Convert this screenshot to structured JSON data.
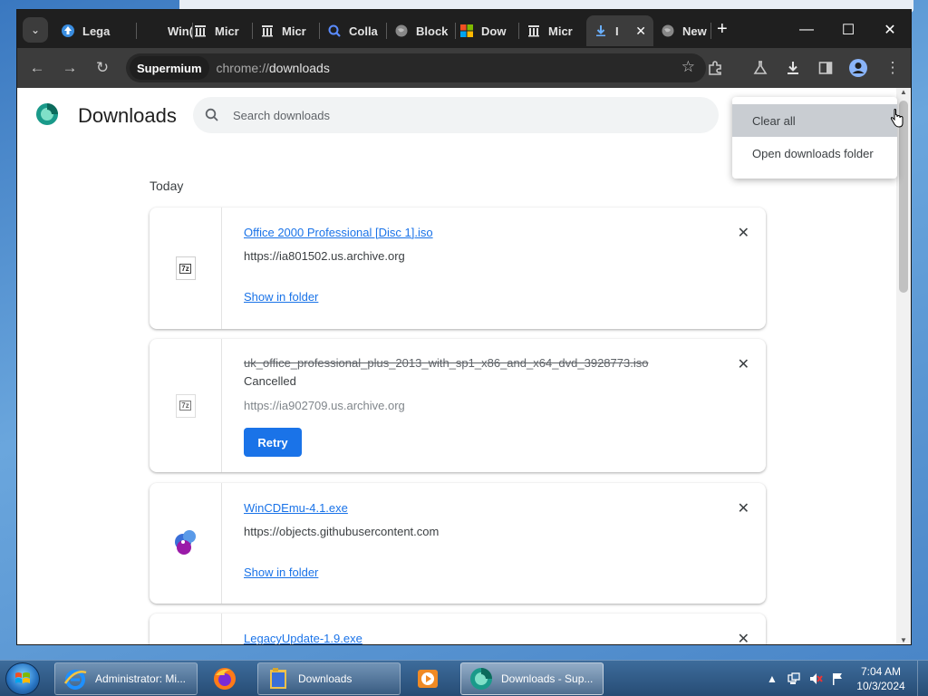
{
  "browser": {
    "tabs": [
      {
        "label": "Lega",
        "icon": "upload-arrow-icon",
        "active": false
      },
      {
        "label": "Win(",
        "icon": "blank-icon",
        "active": false
      },
      {
        "label": "Micr",
        "icon": "archive-icon",
        "active": false
      },
      {
        "label": "Micr",
        "icon": "archive-icon",
        "active": false
      },
      {
        "label": "Colla",
        "icon": "search-icon",
        "active": false
      },
      {
        "label": "Block",
        "icon": "globe-icon",
        "active": false
      },
      {
        "label": "Dow",
        "icon": "windows-icon",
        "active": false
      },
      {
        "label": "Micr",
        "icon": "archive-icon",
        "active": false
      },
      {
        "label": "I",
        "icon": "download-icon",
        "active": true
      },
      {
        "label": "New",
        "icon": "globe-icon",
        "active": false
      }
    ],
    "profile_chip": "Supermium",
    "url_scheme": "chrome://",
    "url_path": "downloads"
  },
  "page": {
    "title": "Downloads",
    "search_placeholder": "Search downloads",
    "section": "Today",
    "items": [
      {
        "filename": "Office 2000 Professional [Disc 1].iso",
        "source": "https://ia801502.us.archive.org",
        "action": "Show in folder"
      },
      {
        "filename": "uk_office_professional_plus_2013_with_sp1_x86_and_x64_dvd_3928773.iso",
        "status": "Cancelled",
        "source": "https://ia902709.us.archive.org",
        "action": "Retry"
      },
      {
        "filename": "WinCDEmu-4.1.exe",
        "source": "https://objects.githubusercontent.com",
        "action": "Show in folder"
      },
      {
        "filename": "LegacyUpdate-1.9.exe"
      }
    ]
  },
  "menu": {
    "items": [
      "Clear all",
      "Open downloads folder"
    ]
  },
  "taskbar": {
    "buttons": [
      {
        "label": "Administrator: Mi...",
        "icon": "ie-icon"
      },
      {
        "label": "",
        "icon": "firefox-icon"
      },
      {
        "label": "Downloads",
        "icon": "folder-icon"
      },
      {
        "label": "",
        "icon": "media-player-icon"
      },
      {
        "label": "Downloads - Sup...",
        "icon": "supermium-icon"
      }
    ],
    "time": "7:04 AM",
    "date": "10/3/2024"
  }
}
